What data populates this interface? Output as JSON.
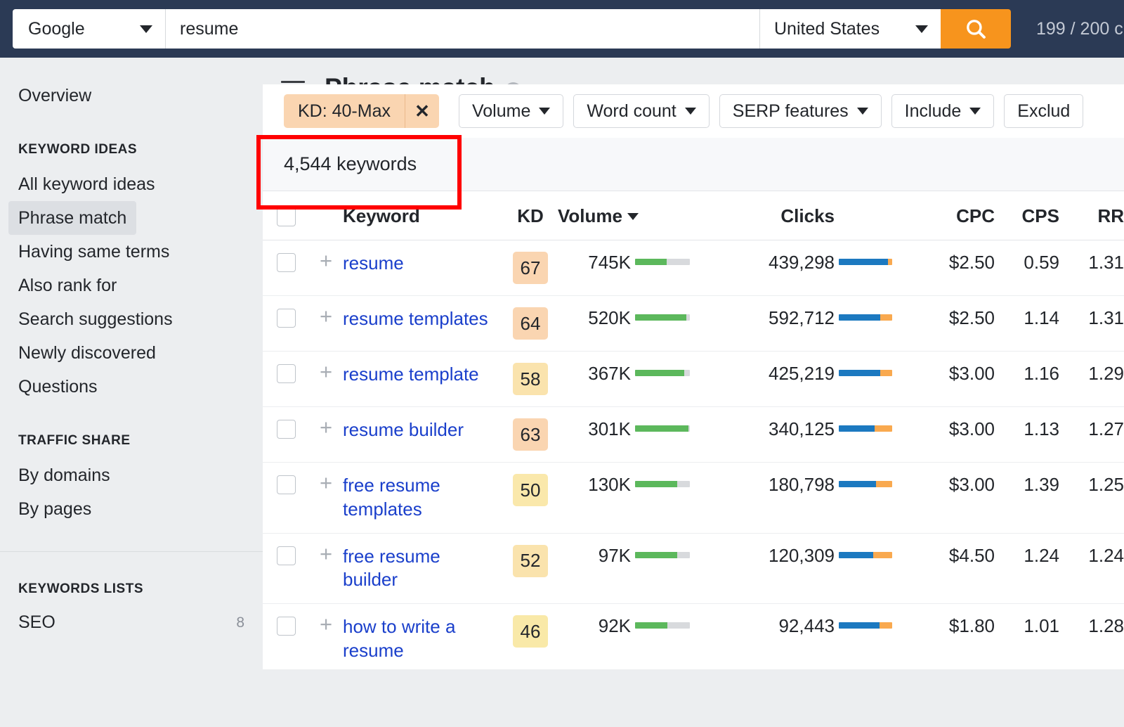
{
  "topbar": {
    "engine": "Google",
    "engine_icon": "chevron-down-icon",
    "query": "resume",
    "country": "United States",
    "search_icon": "search-icon",
    "credits": "199 / 200 c"
  },
  "sidebar": {
    "overview": "Overview",
    "sections": [
      {
        "heading": "KEYWORD IDEAS",
        "items": [
          {
            "label": "All keyword ideas",
            "active": false
          },
          {
            "label": "Phrase match",
            "active": true
          },
          {
            "label": "Having same terms",
            "active": false
          },
          {
            "label": "Also rank for",
            "active": false
          },
          {
            "label": "Search suggestions",
            "active": false
          },
          {
            "label": "Newly discovered",
            "active": false
          },
          {
            "label": "Questions",
            "active": false
          }
        ]
      },
      {
        "heading": "TRAFFIC SHARE",
        "items": [
          {
            "label": "By domains",
            "active": false
          },
          {
            "label": "By pages",
            "active": false
          }
        ]
      }
    ],
    "lists_heading": "KEYWORDS LISTS",
    "lists": [
      {
        "label": "SEO",
        "count": "8"
      }
    ]
  },
  "page": {
    "menu_icon": "hamburger-menu-icon",
    "title": "Phrase match",
    "help_icon": "help-question-icon"
  },
  "filters": {
    "active_chip": {
      "label": "KD: 40-Max",
      "remove_icon": "close-x-icon"
    },
    "buttons": [
      {
        "label": "Volume"
      },
      {
        "label": "Word count"
      },
      {
        "label": "SERP features"
      },
      {
        "label": "Include"
      },
      {
        "label": "Exclud"
      }
    ]
  },
  "results": {
    "count_text": "4,544 keywords",
    "columns": {
      "keyword": "Keyword",
      "kd": "KD",
      "volume": "Volume",
      "clicks": "Clicks",
      "cpc": "CPC",
      "cps": "CPS",
      "rr": "RR"
    },
    "sort": {
      "column": "Volume",
      "direction": "desc",
      "icon": "sort-descending-icon"
    },
    "rows": [
      {
        "keyword": "resume",
        "kd": "67",
        "kd_color": "#fad5b1",
        "volume": "745K",
        "volume_pct": 58,
        "clicks": "439,298",
        "cpc_blue_pct": 92,
        "cpc": "$2.50",
        "cps": "0.59",
        "rr": "1.31"
      },
      {
        "keyword": "resume templates",
        "kd": "64",
        "kd_color": "#fad5b1",
        "volume": "520K",
        "volume_pct": 93,
        "clicks": "592,712",
        "cpc_blue_pct": 78,
        "cpc": "$2.50",
        "cps": "1.14",
        "rr": "1.31"
      },
      {
        "keyword": "resume template",
        "kd": "58",
        "kd_color": "#fae3ad",
        "volume": "367K",
        "volume_pct": 90,
        "clicks": "425,219",
        "cpc_blue_pct": 78,
        "cpc": "$3.00",
        "cps": "1.16",
        "rr": "1.29"
      },
      {
        "keyword": "resume builder",
        "kd": "63",
        "kd_color": "#fad5b1",
        "volume": "301K",
        "volume_pct": 97,
        "clicks": "340,125",
        "cpc_blue_pct": 67,
        "cpc": "$3.00",
        "cps": "1.13",
        "rr": "1.27"
      },
      {
        "keyword": "free resume templates",
        "kd": "50",
        "kd_color": "#fae8ab",
        "volume": "130K",
        "volume_pct": 77,
        "clicks": "180,798",
        "cpc_blue_pct": 70,
        "cpc": "$3.00",
        "cps": "1.39",
        "rr": "1.25"
      },
      {
        "keyword": "free resume builder",
        "kd": "52",
        "kd_color": "#fae3ad",
        "volume": "97K",
        "volume_pct": 77,
        "clicks": "120,309",
        "cpc_blue_pct": 64,
        "cpc": "$4.50",
        "cps": "1.24",
        "rr": "1.24"
      },
      {
        "keyword": "how to write a resume",
        "kd": "46",
        "kd_color": "#f9e9a8",
        "volume": "92K",
        "volume_pct": 59,
        "clicks": "92,443",
        "cpc_blue_pct": 76,
        "cpc": "$1.80",
        "cps": "1.01",
        "rr": "1.28"
      }
    ]
  },
  "annotation": {
    "type": "red-highlight-box",
    "target": "kd-filter-chip"
  }
}
